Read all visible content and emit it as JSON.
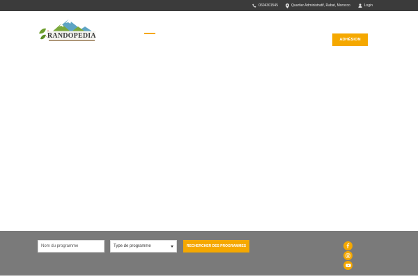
{
  "topbar": {
    "phone": "0604301545",
    "address": "Quartier Administratif, Rabat, Morocco",
    "login": "Login"
  },
  "header": {
    "logo_text": "RANDOPEDIA",
    "adhesion_label": "ADHÉSION"
  },
  "search": {
    "name_placeholder": "Nom du programme",
    "type_selected": "Type de programme",
    "search_label": "RECHERCHER DES PROGRAMMES"
  },
  "socials": [
    "facebook-icon",
    "instagram-icon",
    "youtube-icon"
  ],
  "colors": {
    "accent": "#f5a800",
    "topbar": "#3b3b3b",
    "search_band": "#7a7a7a"
  }
}
